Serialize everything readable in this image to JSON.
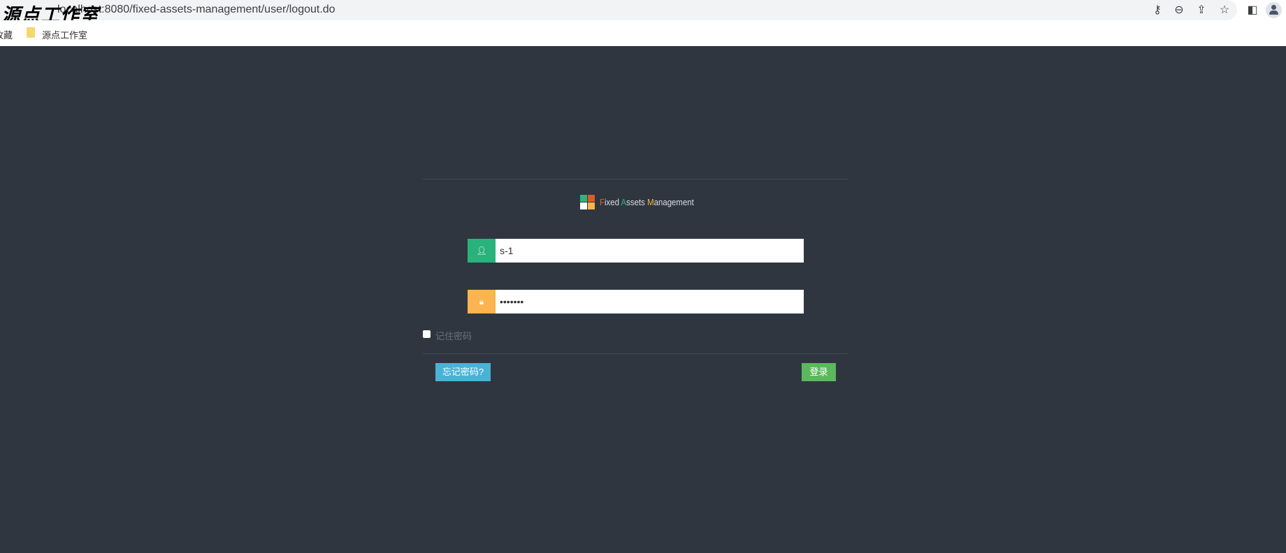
{
  "browser": {
    "url": "localhost:8080/fixed-assets-management/user/logout.do",
    "watermark": "源点工作室",
    "icons": [
      "key-icon",
      "zoom-out-icon",
      "share-icon",
      "star-icon",
      "sidebar-icon",
      "profile-icon"
    ]
  },
  "bookmarks": {
    "items": [
      {
        "label": "收藏"
      },
      {
        "label": "源点工作室"
      }
    ]
  },
  "login": {
    "logo": {
      "letters": [
        "F",
        "ixed ",
        "A",
        "ssets ",
        "M",
        "anagement"
      ],
      "colors": [
        "#e0592a",
        "#2db57d",
        "#f5b642"
      ]
    },
    "username": {
      "value": "s-1"
    },
    "password": {
      "value": "•••••••"
    },
    "remember_label": "记住密码",
    "forgot_label": "忘记密码?",
    "login_label": "登录",
    "colors": {
      "user_icon_bg": "#2ab27b",
      "lock_icon_bg": "#fbb450",
      "forgot_bg": "#49b3d6",
      "login_bg": "#5cb85c"
    }
  }
}
